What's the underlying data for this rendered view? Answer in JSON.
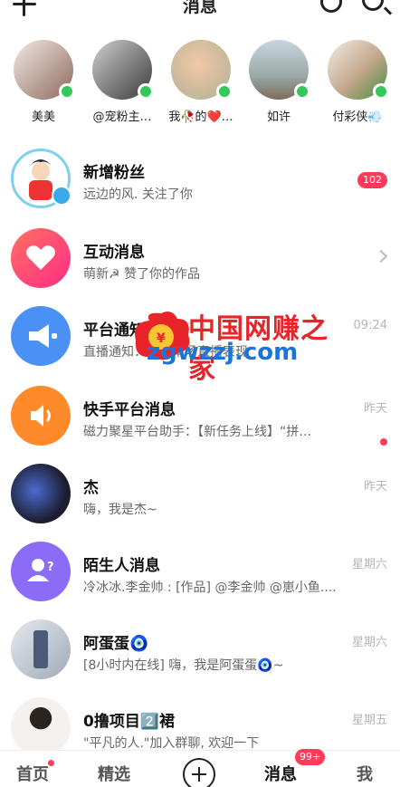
{
  "header": {
    "title": "消息"
  },
  "stories": [
    {
      "name": "美美",
      "color": "#c8b5a8"
    },
    {
      "name": "@宠粉主…",
      "color": "#6e6e6e"
    },
    {
      "name": "我🥀的❤️…",
      "color": "#d7cbb8"
    },
    {
      "name": "如许",
      "color": "#b9c6cf"
    },
    {
      "name": "付彩侠💨",
      "color": "#e1d6c6"
    }
  ],
  "messages": [
    {
      "name": "新增粉丝",
      "sub": "远边的风. 关注了你",
      "time": "",
      "badge": "102",
      "avatar_color": "#d8eef6"
    },
    {
      "name": "互动消息",
      "sub": "萌新☭ 赞了你的作品",
      "time": "",
      "badge": "",
      "avatar_color": "#ff3b7a"
    },
    {
      "name": "平台通知",
      "sub": "直播通知：你的本场直播表现",
      "time": "09:24",
      "badge": "",
      "avatar_color": "#4a90f5"
    },
    {
      "name": "快手平台消息",
      "sub": "磁力聚星平台助手：【新任务上线】“拼…",
      "time": "昨天",
      "badge": "",
      "avatar_color": "#ff8a2a"
    },
    {
      "name": "杰",
      "sub": "嗨，我是杰~",
      "time": "昨天",
      "badge": "",
      "avatar_color": "#2b2f4a"
    },
    {
      "name": "陌生人消息",
      "sub": "冷冰冰.李金帅 : [作品] @李金帅 @崽小鱼....",
      "time": "星期六",
      "badge": "",
      "avatar_color": "#8b6cf6"
    },
    {
      "name": "阿蛋蛋🧿",
      "sub": "[8小时内在线] 嗨，我是阿蛋蛋🧿~",
      "time": "星期六",
      "badge": "",
      "avatar_color": "#aeb8c4"
    },
    {
      "name": "0撸项目2️⃣裙",
      "sub": "\"平凡的人.\"加入群聊, 欢迎一下",
      "time": "星期五",
      "badge": "",
      "avatar_color": "#e9e3dc"
    }
  ],
  "watermark": {
    "cn": "中国网赚之家",
    "url": "zgwzzj.com"
  },
  "bottom_nav": {
    "home": "首页",
    "featured": "精选",
    "messages": "消息",
    "messages_badge": "99+",
    "me": "我"
  }
}
